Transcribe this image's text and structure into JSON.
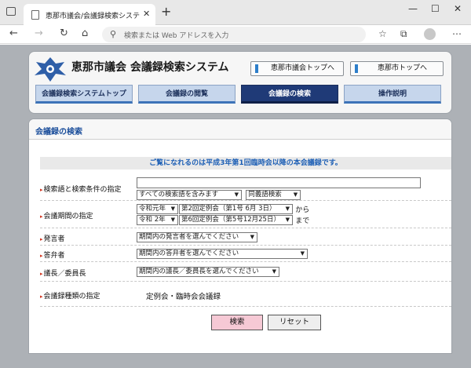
{
  "browser": {
    "tab_title": "恵那市議会/会議録検索システム",
    "address_placeholder": "検索または Web アドレスを入力"
  },
  "header": {
    "site_title": "恵那市議会 会議録検索システム",
    "links": [
      "恵那市議会トップへ",
      "恵那市トップへ"
    ]
  },
  "menu": {
    "items": [
      "会議録検索システムトップ",
      "会議録の閲覧",
      "会議録の検索",
      "操作説明"
    ],
    "active": "会議録の検索"
  },
  "panel": {
    "title": "会議録の検索",
    "notice": "ご覧になれるのは平成3年第1回臨時会以降の本会議録です。"
  },
  "form": {
    "keyword": {
      "label": "検索語と検索条件の指定",
      "value": "",
      "condition": "すべての検索語を含みます",
      "synonym": "同義語検索"
    },
    "period": {
      "label": "会議期間の指定",
      "from_era": "令和元年",
      "from_session": "第2回定例会（第1号 6月 3日）",
      "from_suffix": "から",
      "to_era": "令和 2年",
      "to_session": "第6回定例会（第5号12月25日）",
      "to_suffix": "まで"
    },
    "speaker": {
      "label": "発言者",
      "value": "期間内の発言者を選んでください"
    },
    "respondent": {
      "label": "答弁者",
      "value": "期間内の答弁者を選んでください"
    },
    "chair": {
      "label": "議長／委員長",
      "value": "期間内の議長／委員長を選んでください"
    },
    "type": {
      "label": "会議録種類の指定",
      "value": "定例会・臨時会会議録"
    }
  },
  "buttons": {
    "search": "検索",
    "reset": "リセット"
  },
  "colors": {
    "menu_active": "#1f3a77",
    "accent": "#1d5fb5",
    "search_button": "#f6c9d5"
  }
}
